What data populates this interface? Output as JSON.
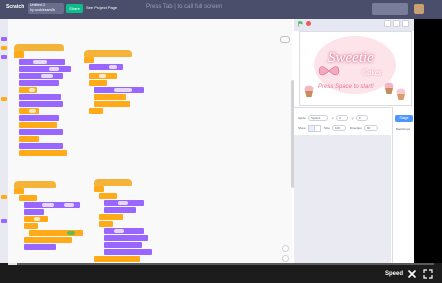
{
  "topbar": {
    "logo": "Scratch",
    "project_title": "Untitled-3",
    "author": "by cookiesam2k",
    "share_label": "Share",
    "see_project_page_label": "See Project Page",
    "overlay_text": "Press Tab | to call full screen"
  },
  "stage": {
    "brand": "Sweetie",
    "brand_sub": "Cakes",
    "prompt": "Press Space to start!"
  },
  "sprite_info": {
    "sprite_label": "Sprite",
    "sprite_name": "Sprite1",
    "x_label": "x",
    "x_value": "0",
    "y_label": "y",
    "y_value": "0",
    "show_label": "Show",
    "size_label": "Size",
    "size_value": "100",
    "direction_label": "Direction",
    "direction_value": "90"
  },
  "stage_column": {
    "tab_label": "Stage",
    "backdrops_label": "Backdrops"
  },
  "player": {
    "speed_label": "Speed",
    "progress": 0.02
  },
  "colors": {
    "topbar": "#4b4e6b",
    "events_hat": "#ffbf00",
    "control": "#ffab19",
    "looks": "#9966ff",
    "operators": "#59c059",
    "motion": "#4c97ff",
    "stop": "#ec5959",
    "flag": "#4cbf56"
  },
  "icons": {
    "flag": "green-flag-icon",
    "stop": "stop-icon",
    "cursor": "cursor-icon",
    "fullscreen": "fullscreen-icon"
  }
}
